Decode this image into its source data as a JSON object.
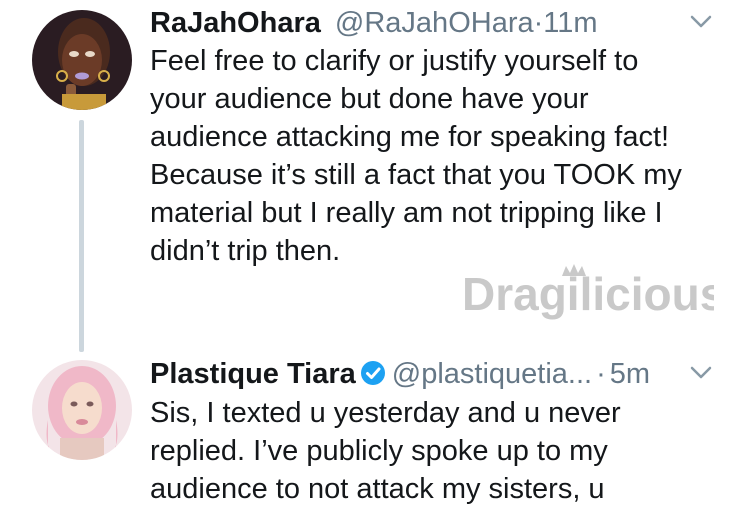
{
  "tweets": [
    {
      "name": "RaJahOhara",
      "handle": "@RaJahOHara",
      "separator": "·",
      "time": "11m",
      "lines": [
        "Feel free to clarify or justify yourself to",
        "your audience but done have your",
        "audience attacking me for speaking fact!",
        "Because it’s still a fact that you TOOK my",
        "material but I really am not tripping like I",
        "didn’t trip then."
      ]
    },
    {
      "name": "Plastique Tiara",
      "handle": "@plastiquetia...",
      "separator": "·",
      "time": "5m",
      "lines": [
        "Sis, I texted u yesterday and u never",
        "replied. I’ve publicly spoke up to my",
        "audience to not attack my sisters, u"
      ]
    }
  ],
  "watermark": {
    "text": "Dragilicious",
    "icon": "crown-icon"
  },
  "colors": {
    "muted": "#657786",
    "verified": "#1da1f2",
    "thread_line": "#ccd6dd"
  }
}
